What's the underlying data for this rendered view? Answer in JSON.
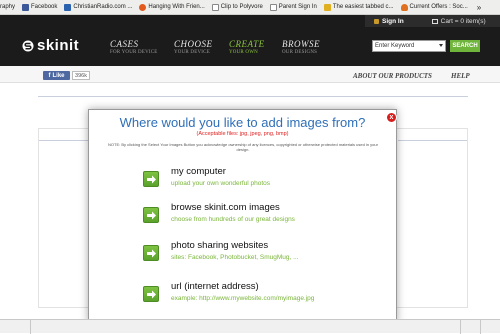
{
  "bookmarks": {
    "items": [
      {
        "label": "raphy",
        "color": "#9aa6b8"
      },
      {
        "label": "Facebook",
        "color": "#3b5998"
      },
      {
        "label": "ChristianRadio.com ...",
        "color": "#2a62b0"
      },
      {
        "label": "Hanging With Frien...",
        "color": "#e25a1d"
      },
      {
        "label": "Clip to Polyvore",
        "color": "#ffffff"
      },
      {
        "label": "Parent Sign In",
        "color": "#ffffff"
      },
      {
        "label": "The easiest tabbed c...",
        "color": "#e0b020"
      },
      {
        "label": "Current Offers : Soc...",
        "color": "#e07020"
      }
    ],
    "more": "»"
  },
  "header": {
    "logo": "skinit",
    "sign_in": "Sign In",
    "cart": "Cart = 0 item(s)",
    "nav": [
      {
        "title": "CASES",
        "sub": "FOR YOUR DEVICE"
      },
      {
        "title": "CHOOSE",
        "sub": "YOUR DEVICE"
      },
      {
        "title": "CREATE",
        "sub": "YOUR OWN"
      },
      {
        "title": "BROWSE",
        "sub": "OUR DESIGNS"
      }
    ],
    "search_select": "Enter Keyword",
    "search_button": "SEARCH"
  },
  "subbar": {
    "like": "Like",
    "like_count": "396k",
    "about": "ABOUT OUR PRODUCTS",
    "help": "HELP"
  },
  "modal": {
    "title": "Where would you like to add images from?",
    "accepted": "(Acceptable files: jpg, jpeg, png, bmp)",
    "note": "NOTE: By clicking the Select Your Images Button you acknowledge ownership of any licences, copyrighted or otherwise protected materials used in your design.",
    "close": "x",
    "options": [
      {
        "title": "my computer",
        "sub": "upload your own wonderful photos"
      },
      {
        "title": "browse skinit.com images",
        "sub": "choose from hundreds of our great designs"
      },
      {
        "title": "photo sharing websites",
        "sub": "sites: Facebook, Photobucket, SmugMug, ..."
      },
      {
        "title": "url (internet address)",
        "sub": "example: http://www.mywebsite.com/myimage.jpg"
      }
    ]
  },
  "colors": {
    "accent_green": "#8cc63e",
    "title_blue": "#2f6fb8",
    "close_red": "#d81d1d"
  }
}
